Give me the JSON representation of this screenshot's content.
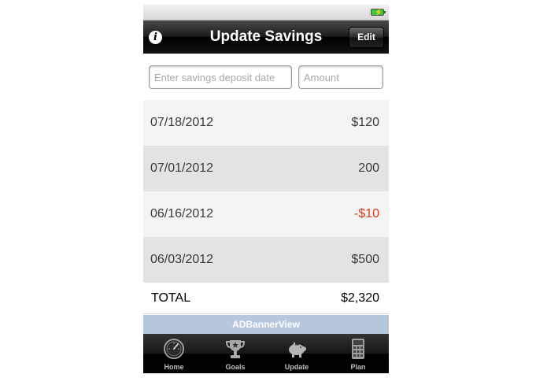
{
  "statusbar": {
    "battery_icon": "battery-charging-icon"
  },
  "navbar": {
    "title": "Update Savings",
    "info_icon": "info-icon",
    "edit_label": "Edit"
  },
  "inputs": {
    "date_placeholder": "Enter savings deposit date",
    "amount_placeholder": "Amount"
  },
  "entries": [
    {
      "date": "07/18/2012",
      "amount": "$120"
    },
    {
      "date": "07/01/2012",
      "amount": "200"
    },
    {
      "date": "06/16/2012",
      "amount": "-$10"
    },
    {
      "date": "06/03/2012",
      "amount": "$500"
    }
  ],
  "total": {
    "label": "TOTAL",
    "value": "$2,320"
  },
  "ad_banner": {
    "label": "ADBannerView"
  },
  "tabbar": {
    "tabs": [
      {
        "label": "Home",
        "icon": "speedometer-icon"
      },
      {
        "label": "Goals",
        "icon": "trophy-icon"
      },
      {
        "label": "Update",
        "icon": "piggy-bank-icon"
      },
      {
        "label": "Plan",
        "icon": "calculator-icon"
      }
    ]
  },
  "colors": {
    "negative_amount": "#d9391c",
    "ad_banner_bg": "#b7c7dd",
    "navbar_bg": "#000000"
  }
}
